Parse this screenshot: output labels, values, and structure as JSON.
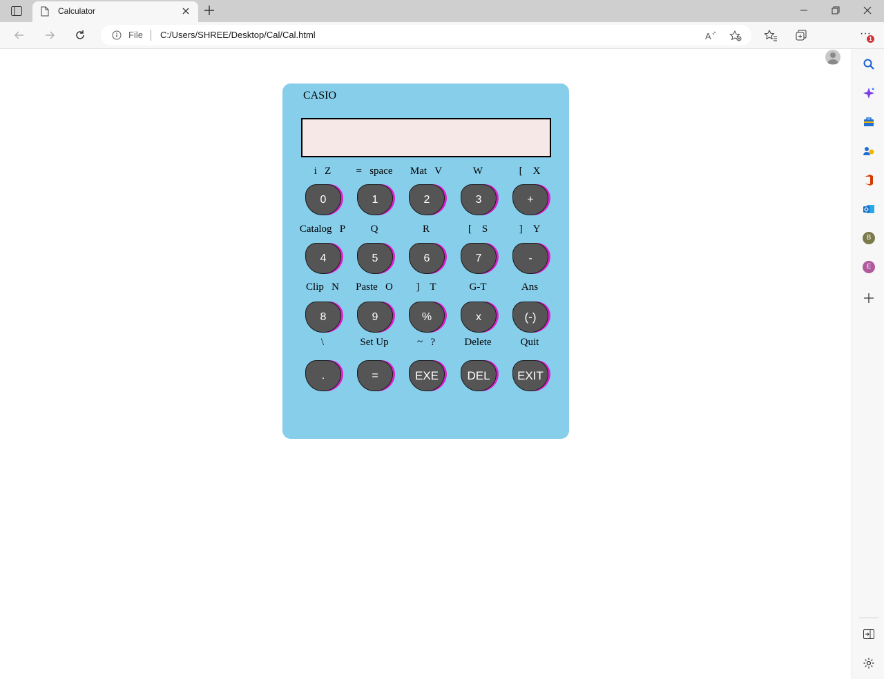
{
  "browser": {
    "tab_title": "Calculator",
    "address": {
      "protocol_label": "File",
      "url": "C:/Users/SHREE/Desktop/Cal/Cal.html"
    },
    "notification_count": "1",
    "sidebar_profiles": [
      {
        "letter": "B",
        "color": "#7a7a4a"
      },
      {
        "letter": "E",
        "color": "#b05a9e"
      }
    ]
  },
  "calculator": {
    "brand": "CASIO",
    "display_value": "",
    "rows": [
      {
        "labels": [
          "i   Z",
          "=   space",
          "Mat   V",
          "W",
          "[    X"
        ],
        "keys": [
          "0",
          "1",
          "2",
          "3",
          "+"
        ]
      },
      {
        "labels": [
          "Catalog   P",
          "Q",
          "R",
          "[    S",
          "]    Y"
        ],
        "keys": [
          "4",
          "5",
          "6",
          "7",
          "-"
        ]
      },
      {
        "labels": [
          "Clip   N",
          "Paste   O",
          "]    T",
          "G-T",
          "Ans"
        ],
        "keys": [
          "8",
          "9",
          "%",
          "x",
          "(-)"
        ]
      },
      {
        "labels": [
          "\\",
          "Set Up",
          "~   ?",
          "Delete",
          "Quit"
        ],
        "keys": [
          ".",
          "=",
          "EXE",
          "DEL",
          "EXIT"
        ]
      }
    ]
  },
  "colors": {
    "calculator_body": "#87ceeb",
    "display_bg": "#f6e8e7",
    "key_bg": "#555555",
    "key_shadow": "#e020d0"
  }
}
